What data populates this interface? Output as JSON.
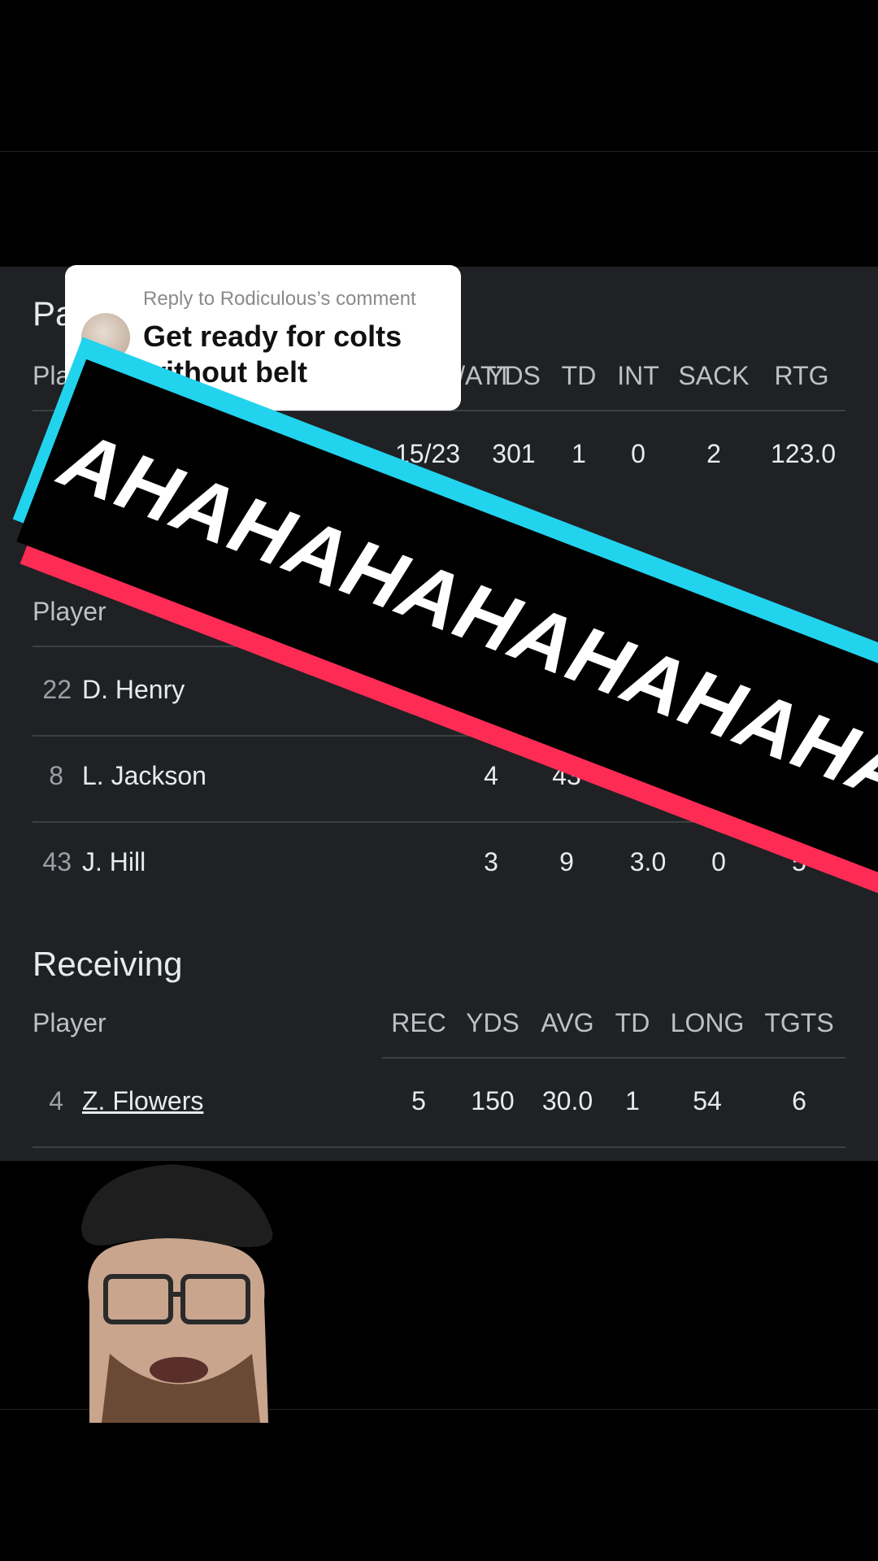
{
  "reply": {
    "label": "Reply to Rodiculous’s comment",
    "text": "Get ready for colts without belt"
  },
  "banner": {
    "text": "AHAHAHAHAHAHAHA"
  },
  "passing": {
    "title": "Passing",
    "headers": [
      "Player",
      "C/ATT",
      "YDS",
      "TD",
      "INT",
      "SACK",
      "RTG"
    ],
    "rows": [
      {
        "cells": [
          "15/23",
          "301",
          "1",
          "0",
          "2",
          "123.0"
        ]
      }
    ]
  },
  "rushing": {
    "header_player": "Player",
    "rows": [
      {
        "number": "22",
        "name": "D. Henry"
      },
      {
        "number": "8",
        "name": "L. Jackson",
        "cells": [
          "4",
          "43"
        ]
      },
      {
        "number": "43",
        "name": "J. Hill",
        "cells": [
          "3",
          "9",
          "3.0",
          "0",
          "5"
        ]
      }
    ]
  },
  "receiving": {
    "title": "Receiving",
    "headers": [
      "Player",
      "REC",
      "YDS",
      "AVG",
      "TD",
      "LONG",
      "TGTS"
    ],
    "rows": [
      {
        "number": "4",
        "name": "Z. Flowers",
        "cells": [
          "5",
          "150",
          "30.0",
          "1",
          "54",
          "6"
        ]
      }
    ]
  },
  "colors": {
    "panel": "#202124",
    "banner_cyan": "#22d3ee",
    "banner_red": "#fe2c55"
  }
}
